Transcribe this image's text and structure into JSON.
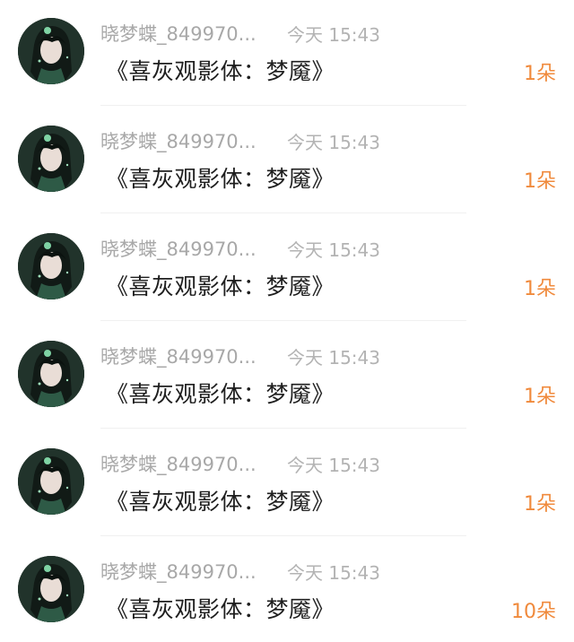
{
  "entries": [
    {
      "username": "晓梦蝶_849970...",
      "time": "今天 15:43",
      "title": "《喜灰观影体：梦魇》",
      "count": "1朵"
    },
    {
      "username": "晓梦蝶_849970...",
      "time": "今天 15:43",
      "title": "《喜灰观影体：梦魇》",
      "count": "1朵"
    },
    {
      "username": "晓梦蝶_849970...",
      "time": "今天 15:43",
      "title": "《喜灰观影体：梦魇》",
      "count": "1朵"
    },
    {
      "username": "晓梦蝶_849970...",
      "time": "今天 15:43",
      "title": "《喜灰观影体：梦魇》",
      "count": "1朵"
    },
    {
      "username": "晓梦蝶_849970...",
      "time": "今天 15:43",
      "title": "《喜灰观影体：梦魇》",
      "count": "1朵"
    },
    {
      "username": "晓梦蝶_849970...",
      "time": "今天 15:43",
      "title": "《喜灰观影体：梦魇》",
      "count": "10朵"
    }
  ],
  "colors": {
    "count_accent": "#f08a3c",
    "meta_gray": "#a8a8a8"
  }
}
